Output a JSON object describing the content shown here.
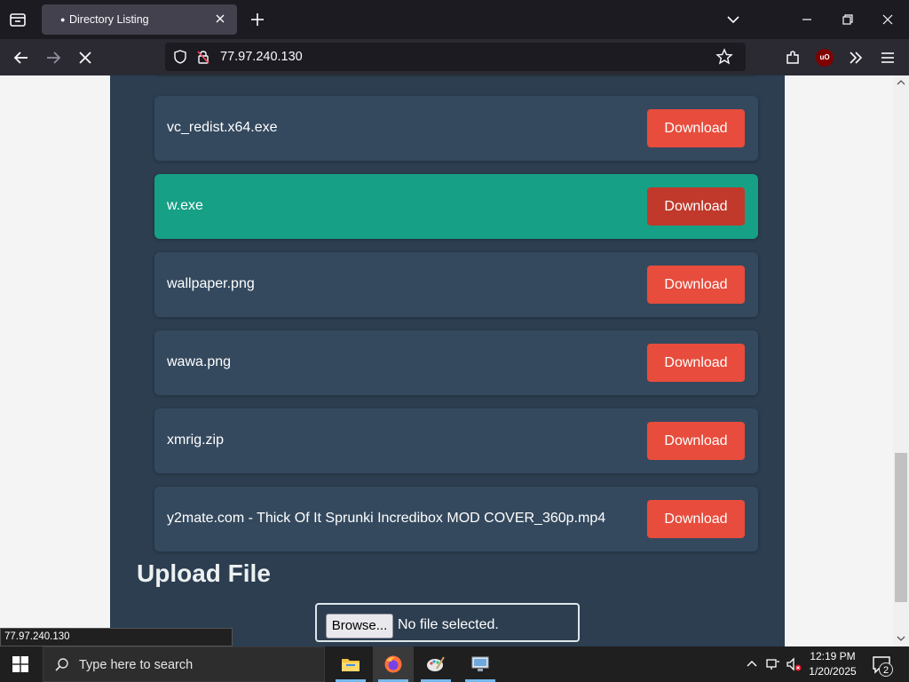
{
  "browser": {
    "tab_title": "Directory Listing",
    "url": "77.97.240.130",
    "status_url": "77.97.240.130"
  },
  "files": [
    {
      "name": "vc_redist.x64.exe",
      "button": "Download",
      "highlighted": false
    },
    {
      "name": "w.exe",
      "button": "Download",
      "highlighted": true
    },
    {
      "name": "wallpaper.png",
      "button": "Download",
      "highlighted": false
    },
    {
      "name": "wawa.png",
      "button": "Download",
      "highlighted": false
    },
    {
      "name": "xmrig.zip",
      "button": "Download",
      "highlighted": false
    },
    {
      "name": "y2mate.com - Thick Of It Sprunki Incredibox MOD COVER_360p.mp4",
      "button": "Download",
      "highlighted": false
    }
  ],
  "upload": {
    "heading": "Upload File",
    "browse_label": "Browse...",
    "file_status": "No file selected."
  },
  "taskbar": {
    "search_placeholder": "Type here to search",
    "time": "12:19 PM",
    "date": "1/20/2025",
    "notification_count": "2",
    "apps": [
      "file-explorer",
      "firefox",
      "paint",
      "remote-desktop"
    ]
  },
  "colors": {
    "panel": "#2c3e50",
    "row": "#34495e",
    "row_highlight": "#16a085",
    "button": "#e74c3c",
    "button_hover": "#c0392b"
  }
}
